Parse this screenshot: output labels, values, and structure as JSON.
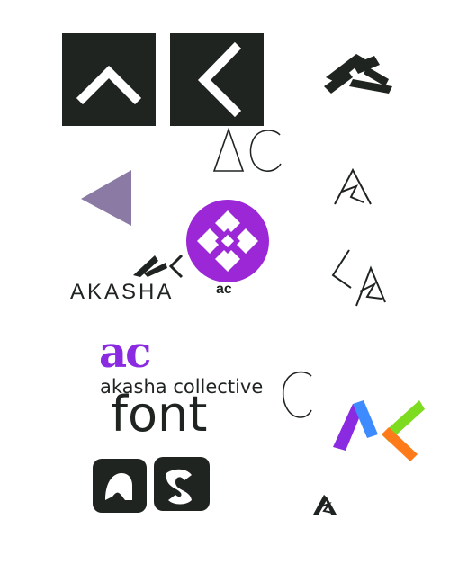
{
  "sheet": {
    "akasha_wordmark": "AKASHA",
    "ac_monogram_small": "ac",
    "collective_name": "akasha collective",
    "font_label": "font",
    "ac_purple_mark": "ac",
    "ac_thin_letters": "AC",
    "c_thin_letter": "C"
  },
  "colors": {
    "dark": "#1f2420",
    "white": "#ffffff",
    "purple": "#9b27d6",
    "mauve": "#8a7aa4",
    "ak_purple": "#8a2be2",
    "ak_blue": "#3d8bff",
    "ak_orange": "#ff7b1a",
    "ak_green": "#7ddc1f"
  },
  "icons": [
    "caret-up-tile-icon",
    "chevron-left-tile-icon",
    "stacked-ak-mark-icon",
    "triangle-icon",
    "purple-swirl-badge-icon",
    "thin-a-mark-icon",
    "thin-ak-mark-icon",
    "colorful-ak-mark-icon",
    "small-a-mark-icon",
    "ac-tile-icon"
  ]
}
